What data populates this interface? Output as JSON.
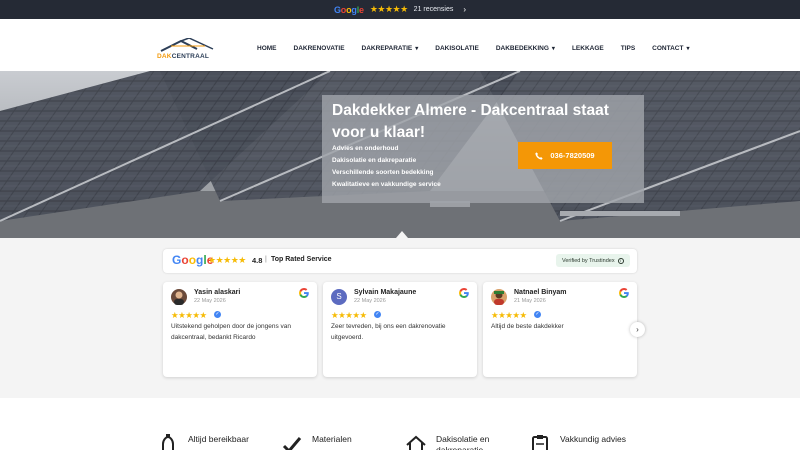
{
  "topbar": {
    "google_text": "Google",
    "stars": "★★★★★",
    "reviews_count": "21 recensies",
    "chevron": "›"
  },
  "header": {
    "logo_text_prefix": "DAK",
    "logo_text_suffix": "CENTRAAL",
    "nav": [
      {
        "label": "HOME",
        "has_dropdown": false
      },
      {
        "label": "DAKRENOVATIE",
        "has_dropdown": false
      },
      {
        "label": "DAKREPARATIE",
        "has_dropdown": true
      },
      {
        "label": "DAKISOLATIE",
        "has_dropdown": false
      },
      {
        "label": "DAKBEDEKKING",
        "has_dropdown": true
      },
      {
        "label": "LEKKAGE",
        "has_dropdown": false
      },
      {
        "label": "TIPS",
        "has_dropdown": false
      },
      {
        "label": "CONTACT",
        "has_dropdown": true
      }
    ]
  },
  "hero": {
    "title": "Dakdekker Almere - Dakcentraal staat voor u klaar!",
    "bullets": [
      "Advies en onderhoud",
      "Dakisolatie en dakreparatie",
      "Verschillende soorten bedekking",
      "Kwalitatieve en vakkundige service"
    ],
    "phone_button": "036-7820509",
    "accent_color": "#f49706"
  },
  "rating_bar": {
    "google_text": "Google",
    "stars": "★★★★★",
    "score": "4.8",
    "separator": "|",
    "label": "Top Rated Service",
    "verified": "Verified by Trustindex",
    "info_icon": "i"
  },
  "reviews": [
    {
      "name": "Yasin alaskari",
      "date": "22 May 2026",
      "stars": "★★★★★",
      "text": "Uitstekend geholpen door de jongens van dakcentraal, bedankt Ricardo",
      "avatar_letter": "",
      "avatar_color": "#6b4a3a"
    },
    {
      "name": "Sylvain Makajaune",
      "date": "22 May 2026",
      "stars": "★★★★★",
      "text": "Zeer tevreden, bij ons een dakrenovatie uitgevoerd.",
      "avatar_letter": "S",
      "avatar_color": "#5c6bc0"
    },
    {
      "name": "Natnael Binyam",
      "date": "21 May 2026",
      "stars": "★★★★★",
      "text": "Altijd de beste dakdekker",
      "avatar_letter": "",
      "avatar_color": "#b0703a"
    }
  ],
  "carousel": {
    "next_arrow": "›"
  },
  "features": [
    {
      "label": "Altijd bereikbaar",
      "icon": "phone-hand-icon"
    },
    {
      "label": "Materialen",
      "icon": "checkmark-icon"
    },
    {
      "label": "Dakisolatie en dakreparatie",
      "icon": "house-roof-icon"
    },
    {
      "label": "Vakkundig advies",
      "icon": "clipboard-icon"
    }
  ]
}
